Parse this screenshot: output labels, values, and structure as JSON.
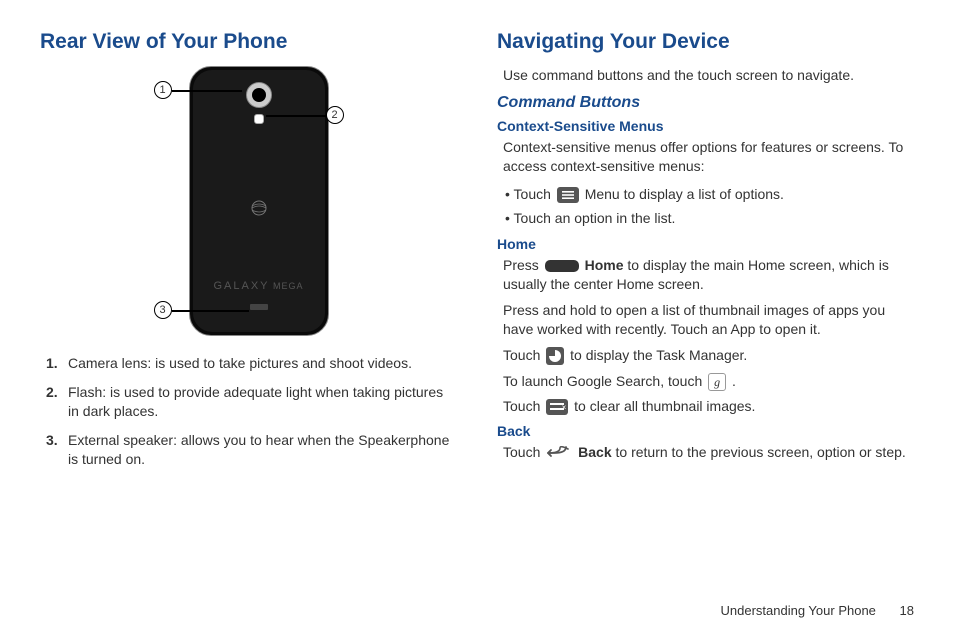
{
  "left": {
    "heading": "Rear View of Your Phone",
    "phone_branding_big": "GALAXY",
    "phone_branding_small": " MEGA",
    "callouts": {
      "c1": "1",
      "c2": "2",
      "c3": "3"
    },
    "items": [
      {
        "num": "1.",
        "term": "Camera lens",
        "desc": ": is used to take pictures and shoot videos."
      },
      {
        "num": "2.",
        "term": "Flash",
        "desc": ": is used to provide adequate light when taking pictures in dark places."
      },
      {
        "num": "3.",
        "term": "External speaker",
        "desc": ": allows you to hear when the Speakerphone is turned on."
      }
    ]
  },
  "right": {
    "heading": "Navigating Your Device",
    "intro": "Use command buttons and the touch screen to navigate.",
    "sub1": "Command Buttons",
    "csm_heading": "Context-Sensitive Menus",
    "csm_text": "Context-sensitive menus offer options for features or screens. To access context-sensitive menus:",
    "csm_bullet1_a": "Touch ",
    "csm_bullet1_b": "Menu",
    "csm_bullet1_c": " to display a list of options.",
    "csm_bullet2": "Touch an option in the list.",
    "home_heading": "Home",
    "home_p1a": "Press ",
    "home_p1b": "Home",
    "home_p1c": " to display the main Home screen, which is usually the center Home screen.",
    "home_p2": "Press and hold to open a list of thumbnail images of apps you have worked with recently. Touch an App to open it.",
    "home_p3a": "Touch ",
    "home_p3b": " to display the Task Manager.",
    "home_p4a": "To launch Google Search, touch ",
    "home_p4b": ".",
    "home_p5a": "Touch ",
    "home_p5b": " to clear all thumbnail images.",
    "back_heading": "Back",
    "back_a": "Touch ",
    "back_b": "Back",
    "back_c": " to return to the previous screen, option or step.",
    "g_label": "g"
  },
  "footer": {
    "section": "Understanding Your Phone",
    "page": "18"
  }
}
